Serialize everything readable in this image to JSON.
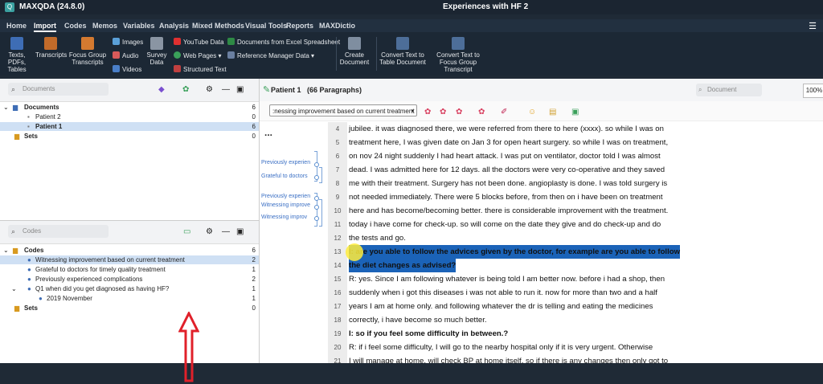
{
  "app": {
    "name": "MAXQDA (24.8.0)",
    "project": "Experiences with HF 2"
  },
  "menu_tabs": [
    "Home",
    "Import",
    "Codes",
    "Memos",
    "Variables",
    "Analysis",
    "Mixed Methods",
    "Visual Tools",
    "Reports",
    "MAXDictio"
  ],
  "active_tab": "Import",
  "ribbon": {
    "texts_pdfs": "Texts, PDFs, Tables",
    "transcripts": "Transcripts",
    "focus_group": "Focus Group Transcripts",
    "images": "Images",
    "audio": "Audio",
    "videos": "Videos",
    "survey_data": "Survey Data",
    "youtube": "YouTube Data",
    "web_pages": "Web Pages",
    "structured_text": "Structured Text",
    "docs_excel": "Documents from Excel Spreadsheet",
    "ref_manager": "Reference Manager Data",
    "create_doc": "Create Document",
    "convert_table": "Convert Text to Table Document",
    "convert_focus": "Convert Text to Focus Group Transcript"
  },
  "documents_panel": {
    "search_placeholder": "Documents",
    "items": [
      {
        "label": "Documents",
        "count": "6"
      },
      {
        "label": "Patient 2",
        "count": "0"
      },
      {
        "label": "Patient 1",
        "count": "6"
      },
      {
        "label": "Sets",
        "count": "0"
      }
    ]
  },
  "codes_panel": {
    "search_placeholder": "Codes",
    "items": [
      {
        "label": "Codes",
        "count": "6"
      },
      {
        "label": "Witnessing improvement based on current treatment",
        "count": "2"
      },
      {
        "label": "Grateful to doctors for timely quality treatment",
        "count": "1"
      },
      {
        "label": "Previously experienced complications",
        "count": "2"
      },
      {
        "label": "Q1 when did you get diagnosed as having HF?",
        "count": "1"
      },
      {
        "label": "2019 November",
        "count": "1"
      },
      {
        "label": "Sets",
        "count": "0"
      }
    ]
  },
  "document_browser": {
    "title": "Patient 1",
    "paragraph_count": "(66 Paragraphs)",
    "search_placeholder": "Document",
    "zoom": "100%",
    "code_selector": ":nessing improvement based on current treatment",
    "more": "...",
    "margin_labels": [
      "Previously experien",
      "Grateful to doctors",
      "Previously experien",
      "Witnessing improve",
      "Witnessing improv"
    ],
    "paragraphs": [
      {
        "n": "4",
        "text": "jubilee. it was diagnosed there, we were referred from there to here (xxxx). so while I was on"
      },
      {
        "n": "5",
        "text": "treatment here, I was given date on Jan 3 for open heart surgery. so while I was on treatment,"
      },
      {
        "n": "6",
        "text": "on nov 24 night suddenly I had heart attack. I was put on ventilator, doctor told I was almost"
      },
      {
        "n": "7",
        "text": "dead. I was admitted here for 12 days. all the doctors were very co-operative and they saved"
      },
      {
        "n": "8",
        "text": "me with their treatment. Surgery has not been done. angioplasty is done. I was told surgery is"
      },
      {
        "n": "9",
        "text": "not needed immediately. There were 5 blocks before, from then on i have been on treatment"
      },
      {
        "n": "10",
        "text": "here and has become/becoming better. there is considerable improvement with the treatment."
      },
      {
        "n": "11",
        "text": "today i have come for check-up. so will come on the date they give and do check-up and do"
      },
      {
        "n": "12",
        "text": "the tests and go."
      },
      {
        "n": "13",
        "text": "I: are you able to follow the advices given by the doctor, for example are you able to follow"
      },
      {
        "n": "14",
        "text": "the diet changes as advised?"
      },
      {
        "n": "15",
        "text": "R: yes. Since I am following whatever is being told I am better now. before i had a shop, then"
      },
      {
        "n": "16",
        "text": "suddenly when i got this diseases i was not able to run it. now for more than two and a half"
      },
      {
        "n": "17",
        "text": "years I am at home only. and following whatever the dr is telling and eating the medicines"
      },
      {
        "n": "18",
        "text": "correctly, i have become so much better."
      },
      {
        "n": "19",
        "text": "I: so if you feel some difficulty in between.?"
      },
      {
        "n": "20",
        "text": "R: if i feel some difficulty, I will go to the nearby hospital only if it is very urgent. Otherwise"
      },
      {
        "n": "21",
        "text": "I will manage at home. will check BP at home itself. so if there is any changes then only got to"
      }
    ]
  },
  "colors": {
    "accent": "#1b63b8",
    "titlebar": "#1b2531",
    "arrow": "#e0202a"
  }
}
